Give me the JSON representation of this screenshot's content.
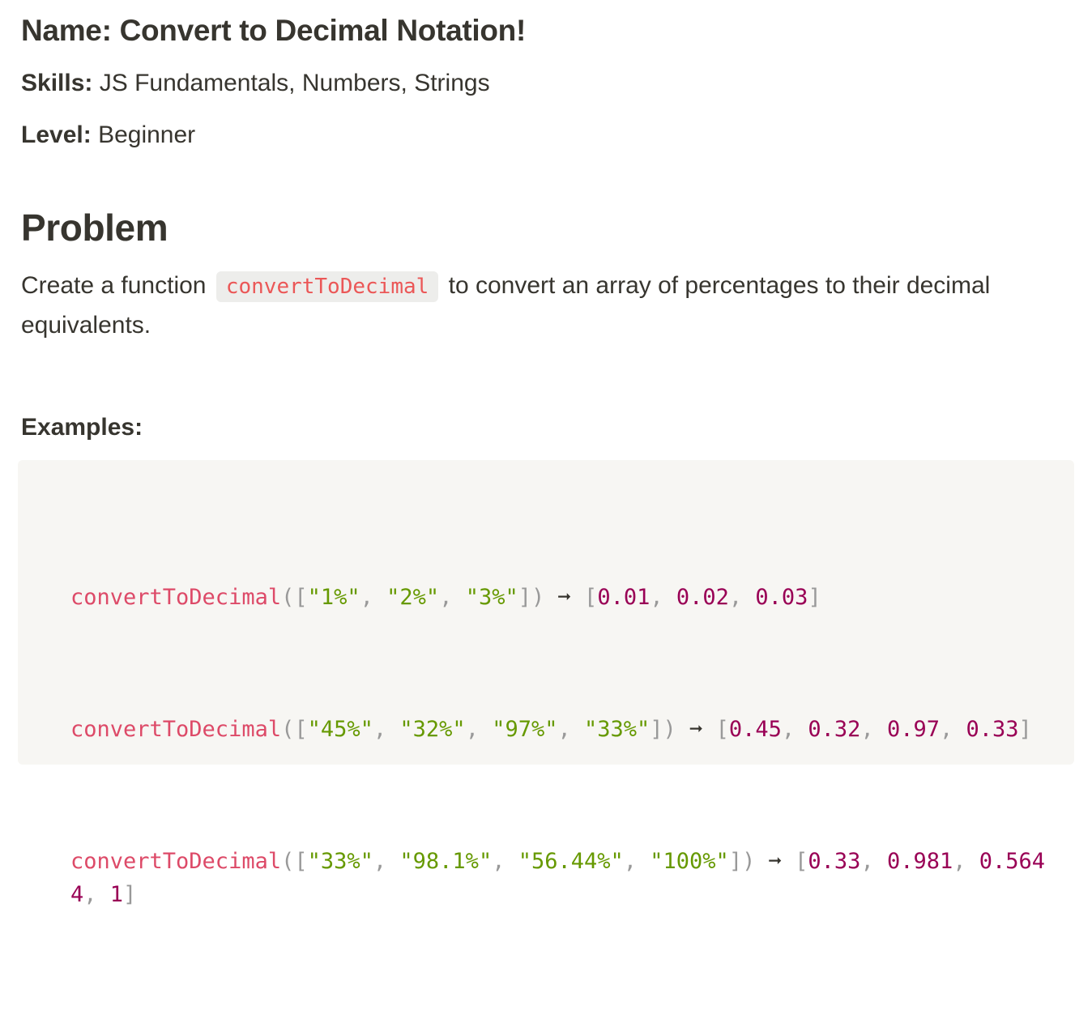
{
  "meta": {
    "title": "Name: Convert to Decimal Notation!",
    "skills_label": "Skills:",
    "skills_value": "JS Fundamentals, Numbers, Strings",
    "level_label": "Level:",
    "level_value": "Beginner"
  },
  "problem": {
    "heading": "Problem",
    "text_before": "Create a function",
    "function_name": "convertToDecimal",
    "text_after": "to convert an array of percentages to their decimal equivalents."
  },
  "examples": {
    "heading": "Examples:",
    "lines": [
      {
        "fn": "convertToDecimal",
        "inputs": [
          "\"1%\"",
          "\"2%\"",
          "\"3%\""
        ],
        "arrow": "➞",
        "outputs": [
          "0.01",
          "0.02",
          "0.03"
        ]
      },
      {
        "fn": "convertToDecimal",
        "inputs": [
          "\"45%\"",
          "\"32%\"",
          "\"97%\"",
          "\"33%\""
        ],
        "arrow": "➞",
        "outputs": [
          "0.45",
          "0.32",
          "0.97",
          "0.33"
        ]
      },
      {
        "fn": "convertToDecimal",
        "inputs": [
          "\"33%\"",
          "\"98.1%\"",
          "\"56.44%\"",
          "\"100%\""
        ],
        "arrow": "➞",
        "outputs": [
          "0.33",
          "0.981",
          "0.5644",
          "1"
        ]
      }
    ]
  }
}
